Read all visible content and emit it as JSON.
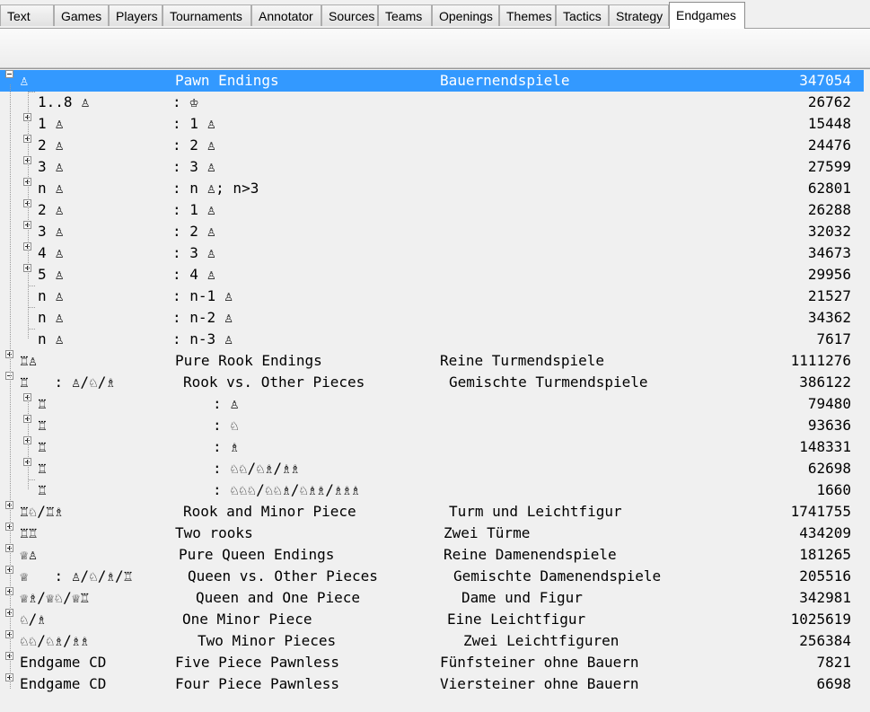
{
  "tabs": [
    "Text",
    "Games",
    "Players",
    "Tournaments",
    "Annotator",
    "Sources",
    "Teams",
    "Openings",
    "Themes",
    "Tactics",
    "Strategy",
    "Endgames"
  ],
  "active_tab": "Endgames",
  "rows": [
    {
      "c1": "♙",
      "c2": "Pawn Endings",
      "c3": "Bauernendspiele",
      "num": "347054",
      "selected": true,
      "expander": "minus",
      "level": 0
    },
    {
      "c1": "1..8 ♙",
      "c2": ": ♔",
      "c3": "",
      "num": "26762",
      "expander": "none",
      "level": 1
    },
    {
      "c1": "1 ♙",
      "c2": ": 1 ♙",
      "c3": "",
      "num": "15448",
      "expander": "plus",
      "level": 1
    },
    {
      "c1": "2 ♙",
      "c2": ": 2 ♙",
      "c3": "",
      "num": "24476",
      "expander": "plus",
      "level": 1
    },
    {
      "c1": "3 ♙",
      "c2": ": 3 ♙",
      "c3": "",
      "num": "27599",
      "expander": "plus",
      "level": 1
    },
    {
      "c1": "n ♙",
      "c2": ": n ♙; n>3",
      "c3": "",
      "num": "62801",
      "expander": "plus",
      "level": 1
    },
    {
      "c1": "2 ♙",
      "c2": ": 1 ♙",
      "c3": "",
      "num": "26288",
      "expander": "plus",
      "level": 1
    },
    {
      "c1": "3 ♙",
      "c2": ": 2 ♙",
      "c3": "",
      "num": "32032",
      "expander": "plus",
      "level": 1
    },
    {
      "c1": "4 ♙",
      "c2": ": 3 ♙",
      "c3": "",
      "num": "34673",
      "expander": "plus",
      "level": 1
    },
    {
      "c1": "5 ♙",
      "c2": ": 4 ♙",
      "c3": "",
      "num": "29956",
      "expander": "plus",
      "level": 1
    },
    {
      "c1": "n ♙",
      "c2": ": n-1 ♙",
      "c3": "",
      "num": "21527",
      "expander": "none",
      "level": 1
    },
    {
      "c1": "n ♙",
      "c2": ": n-2 ♙",
      "c3": "",
      "num": "34362",
      "expander": "none",
      "level": 1
    },
    {
      "c1": "n ♙",
      "c2": ": n-3 ♙",
      "c3": "",
      "num": "7617",
      "expander": "none",
      "level": 1
    },
    {
      "c1": "♖♙",
      "c2": "Pure Rook Endings",
      "c3": "Reine Turmendspiele",
      "num": "1111276",
      "expander": "plus",
      "level": 0
    },
    {
      "c1": "♖   : ♙/♘/♗",
      "c2": "Rook vs. Other Pieces",
      "c3": "Gemischte Turmendspiele",
      "num": "386122",
      "expander": "minus",
      "level": 0
    },
    {
      "c1": "♖",
      "c2": ": ♙",
      "c3": "",
      "num": "79480",
      "expander": "plus",
      "level": 1
    },
    {
      "c1": "♖",
      "c2": ": ♘",
      "c3": "",
      "num": "93636",
      "expander": "plus",
      "level": 1
    },
    {
      "c1": "♖",
      "c2": ": ♗",
      "c3": "",
      "num": "148331",
      "expander": "plus",
      "level": 1
    },
    {
      "c1": "♖",
      "c2": ": ♘♘/♘♗/♗♗",
      "c3": "",
      "num": "62698",
      "expander": "plus",
      "level": 1
    },
    {
      "c1": "♖",
      "c2": ": ♘♘♘/♘♘♗/♘♗♗/♗♗♗",
      "c3": "",
      "num": "1660",
      "expander": "none",
      "level": 1
    },
    {
      "c1": "♖♘/♖♗",
      "c2": "Rook and Minor Piece",
      "c3": "Turm und Leichtfigur",
      "num": "1741755",
      "expander": "plus",
      "level": 0
    },
    {
      "c1": "♖♖",
      "c2": "Two rooks",
      "c3": "Zwei Türme",
      "num": "434209",
      "expander": "plus",
      "level": 0
    },
    {
      "c1": "♕♙",
      "c2": "Pure Queen Endings",
      "c3": "Reine Damenendspiele",
      "num": "181265",
      "expander": "plus",
      "level": 0
    },
    {
      "c1": "♕   : ♙/♘/♗/♖",
      "c2": "Queen vs. Other Pieces",
      "c3": "Gemischte Damenendspiele",
      "num": "205516",
      "expander": "plus",
      "level": 0
    },
    {
      "c1": "♕♗/♕♘/♕♖",
      "c2": "Queen and One Piece",
      "c3": "Dame und Figur",
      "num": "342981",
      "expander": "plus",
      "level": 0
    },
    {
      "c1": "♘/♗",
      "c2": "One Minor Piece",
      "c3": "Eine Leichtfigur",
      "num": "1025619",
      "expander": "plus",
      "level": 0
    },
    {
      "c1": "♘♘/♘♗/♗♗",
      "c2": "Two Minor Pieces",
      "c3": "Zwei Leichtfiguren",
      "num": "256384",
      "expander": "plus",
      "level": 0
    },
    {
      "c1": "Endgame CD",
      "c2": "Five Piece Pawnless",
      "c3": "Fünfsteiner ohne Bauern",
      "num": "7821",
      "expander": "plus",
      "level": 0
    },
    {
      "c1": "Endgame CD",
      "c2": "Four Piece Pawnless",
      "c3": "Viersteiner ohne Bauern",
      "num": "6698",
      "expander": "plus",
      "level": 0
    }
  ]
}
